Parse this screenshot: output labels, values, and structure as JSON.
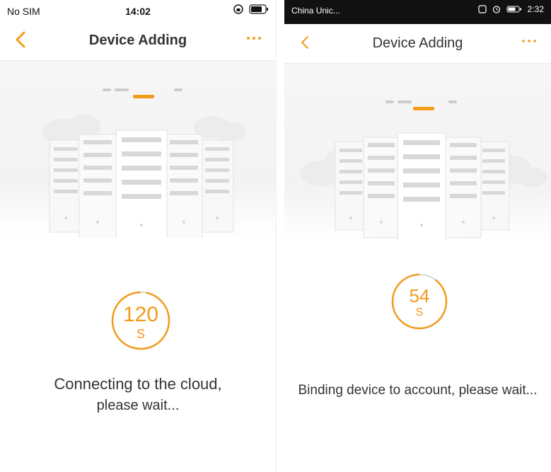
{
  "left_phone": {
    "status": {
      "carrier": "No SIM",
      "time": "14:02"
    },
    "nav": {
      "title": "Device Adding"
    },
    "countdown": {
      "value": "120",
      "unit": "S",
      "progress": 0.97
    },
    "message_line1": "Connecting to the cloud,",
    "message_line2": "please wait..."
  },
  "right_phone": {
    "status": {
      "carrier": "China Unic...",
      "time": "2:32"
    },
    "nav": {
      "title": "Device Adding"
    },
    "countdown": {
      "value": "54",
      "unit": "S",
      "progress": 0.9
    },
    "message": "Binding device to account, please wait..."
  },
  "colors": {
    "accent": "#f39c1a",
    "ring_track": "#dddddd",
    "status_bar_right": "#111111"
  },
  "icons": [
    "back-chevron-icon",
    "more-dots-icon",
    "wifi-icon",
    "battery-icon",
    "alarm-icon",
    "nfc-icon",
    "orientation-lock-icon"
  ]
}
